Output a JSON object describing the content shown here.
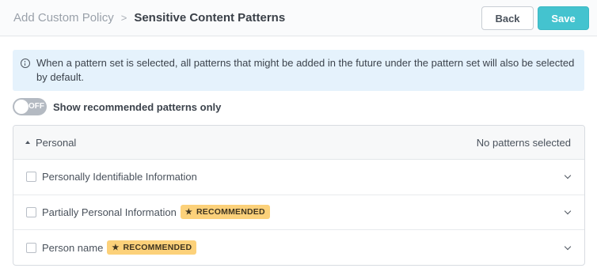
{
  "header": {
    "breadcrumb_parent": "Add Custom Policy",
    "breadcrumb_separator": ">",
    "breadcrumb_current": "Sensitive Content Patterns",
    "back_label": "Back",
    "save_label": "Save"
  },
  "info": {
    "icon": "info-icon",
    "text": "When a pattern set is selected, all patterns that might be added in the future under the pattern set will also be selected by default."
  },
  "toggle": {
    "state_text": "OFF",
    "checked": false,
    "label": "Show recommended patterns only"
  },
  "group": {
    "name": "Personal",
    "expanded": true,
    "status": "No patterns selected",
    "items": [
      {
        "label": "Personally Identifiable Information",
        "checked": false,
        "badge": null
      },
      {
        "label": "Partially Personal Information",
        "checked": false,
        "badge": "RECOMMENDED",
        "badge_icon": "★"
      },
      {
        "label": "Person name",
        "checked": false,
        "badge": "RECOMMENDED",
        "badge_icon": "★"
      }
    ]
  },
  "colors": {
    "accent": "#44c3cf",
    "info_bg": "#e5f2fc",
    "badge_bg": "#fcd17a",
    "toggle_off": "#b4bac2"
  }
}
